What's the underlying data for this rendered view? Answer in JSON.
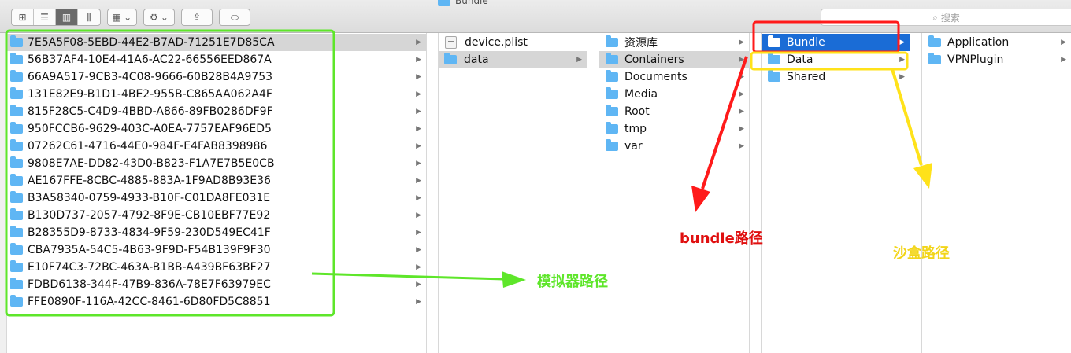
{
  "window": {
    "title": "Bundle"
  },
  "toolbar": {
    "view_buttons": [
      {
        "name": "icon-view-icon",
        "glyph": "⊞"
      },
      {
        "name": "list-view-icon",
        "glyph": "☰"
      },
      {
        "name": "column-view-icon",
        "glyph": "▥"
      },
      {
        "name": "cover-flow-icon",
        "glyph": "⫼"
      }
    ],
    "arrange_glyph": "▦",
    "arrange_caret": "⌄",
    "action_glyph": "⚙",
    "action_caret": "⌄",
    "share_glyph": "⇪",
    "tag_glyph": "⬭",
    "search_glyph": "⌕",
    "search_placeholder": "搜索"
  },
  "columns": {
    "col1": {
      "items": [
        {
          "label": "7E5A5F08-5EBD-44E2-B7AD-71251E7D85CA"
        },
        {
          "label": "56B37AF4-10E4-41A6-AC22-66556EED867A"
        },
        {
          "label": "66A9A517-9CB3-4C08-9666-60B28B4A9753"
        },
        {
          "label": "131E82E9-B1D1-4BE2-955B-C865AA062A4F"
        },
        {
          "label": "815F28C5-C4D9-4BBD-A866-89FB0286DF9F"
        },
        {
          "label": "950FCCB6-9629-403C-A0EA-7757EAF96ED5"
        },
        {
          "label": "07262C61-4716-44E0-984F-E4FAB8398986"
        },
        {
          "label": "9808E7AE-DD82-43D0-B823-F1A7E7B5E0CB"
        },
        {
          "label": "AE167FFE-8CBC-4885-883A-1F9AD8B93E36"
        },
        {
          "label": "B3A58340-0759-4933-B10F-C01DA8FE031E"
        },
        {
          "label": "B130D737-2057-4792-8F9E-CB10EBF77E92"
        },
        {
          "label": "B28355D9-8733-4834-9F59-230D549EC41F"
        },
        {
          "label": "CBA7935A-54C5-4B63-9F9D-F54B139F9F30"
        },
        {
          "label": "E10F74C3-72BC-463A-B1BB-A439BF63BF27"
        },
        {
          "label": "FDBD6138-344F-47B9-836A-78E7F63979EC"
        },
        {
          "label": "FFE0890F-116A-42CC-8461-6D80FD5C8851"
        }
      ]
    },
    "col2": {
      "items": [
        {
          "label": "device.plist"
        },
        {
          "label": "data"
        }
      ]
    },
    "col3": {
      "items": [
        {
          "label": "资源库"
        },
        {
          "label": "Containers"
        },
        {
          "label": "Documents"
        },
        {
          "label": "Media"
        },
        {
          "label": "Root"
        },
        {
          "label": "tmp"
        },
        {
          "label": "var"
        }
      ]
    },
    "col4": {
      "items": [
        {
          "label": "Bundle"
        },
        {
          "label": "Data"
        },
        {
          "label": "Shared"
        }
      ]
    },
    "col5": {
      "items": [
        {
          "label": "Application"
        },
        {
          "label": "VPNPlugin"
        }
      ]
    }
  },
  "annotations": {
    "simulator_path": "模拟器路径",
    "bundle_path": "bundle路径",
    "sandbox_path": "沙盒路径",
    "colors": {
      "green": "#5ee62a",
      "red": "#ff1a1a",
      "yellow": "#ffe21a"
    }
  }
}
